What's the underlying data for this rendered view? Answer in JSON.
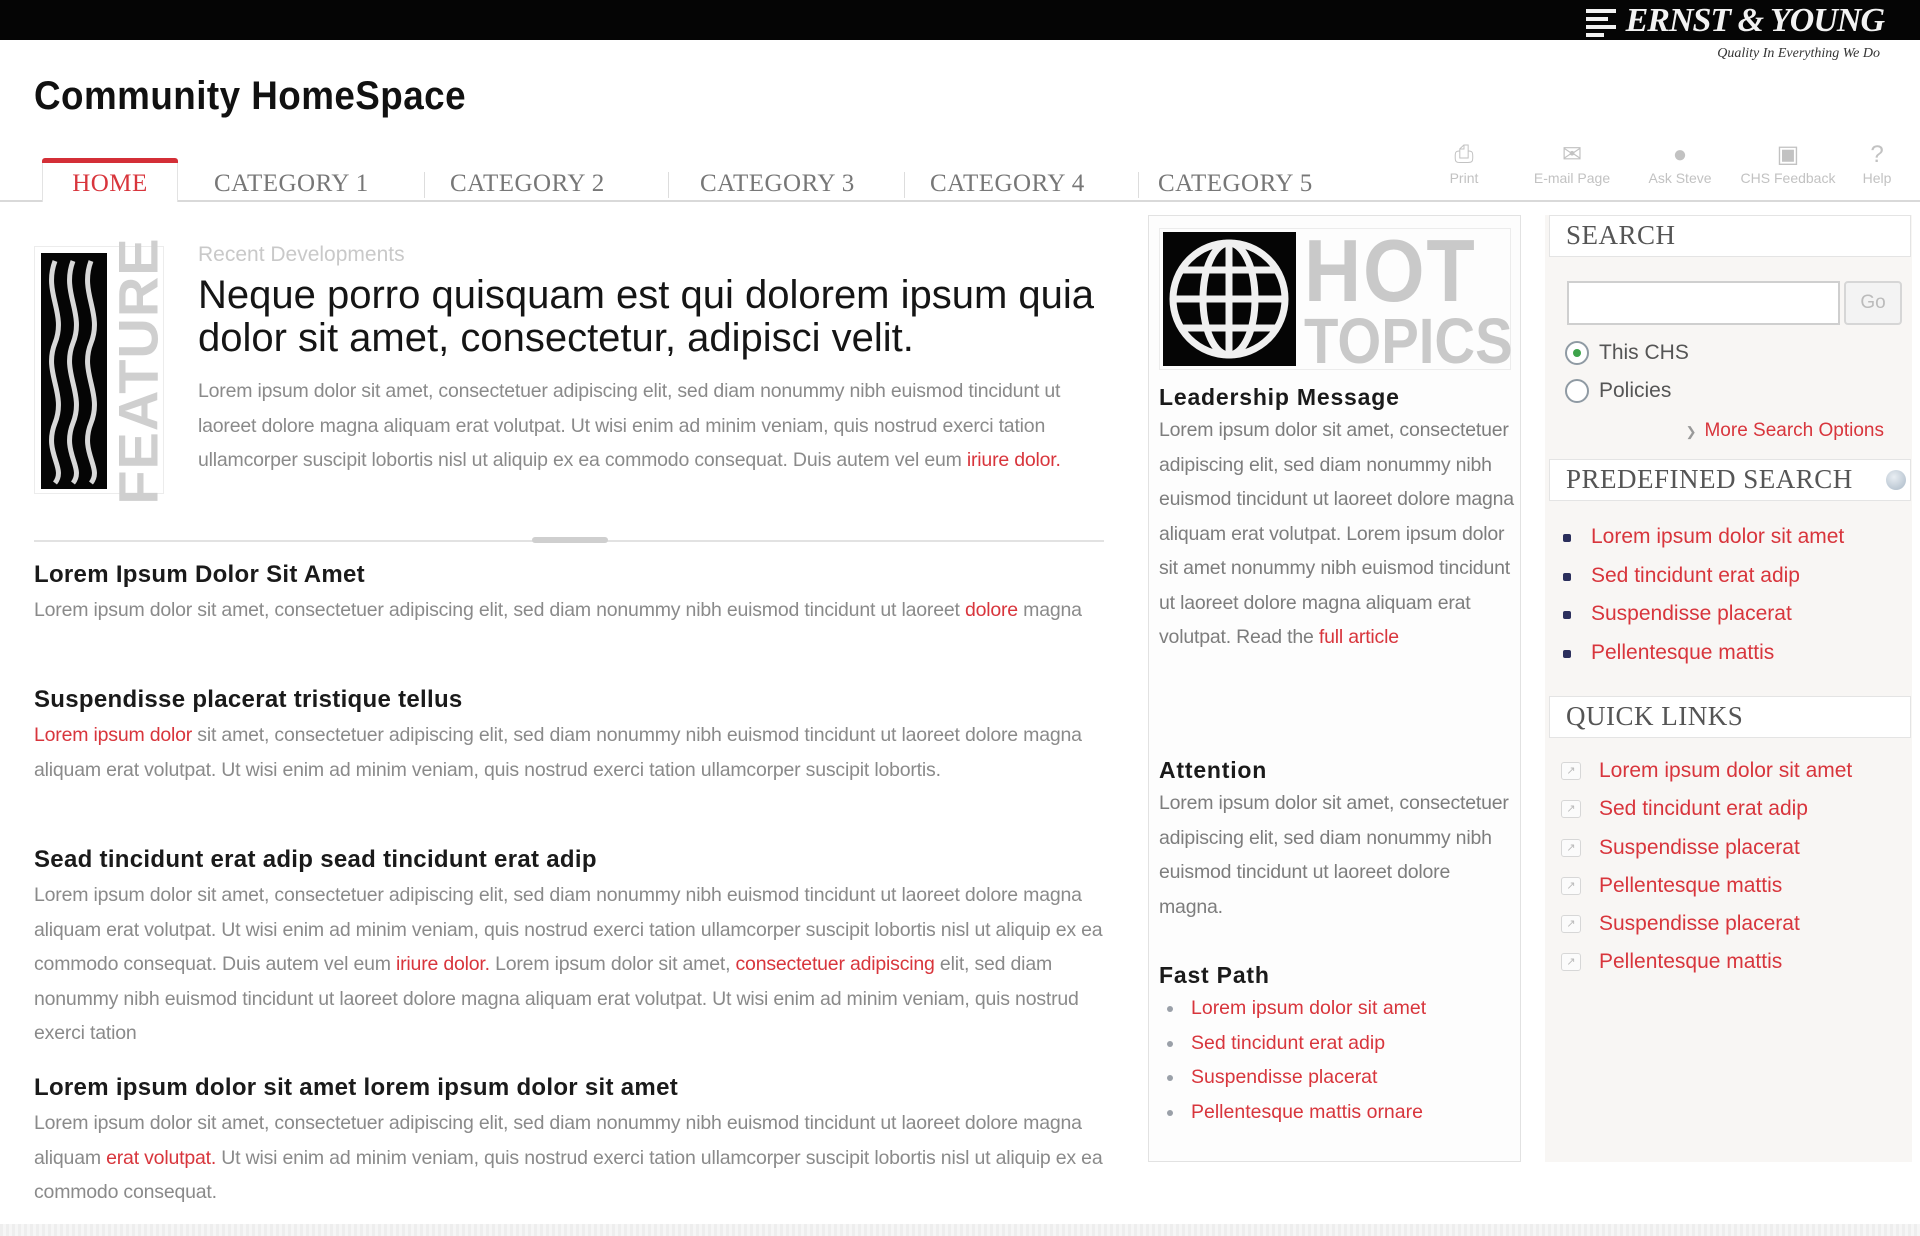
{
  "brand": {
    "logo_text": "ERNST & YOUNG",
    "tagline": "Quality In Everything We Do"
  },
  "header": {
    "title": "Community HomeSpace"
  },
  "nav": {
    "tabs": [
      {
        "label": "HOME",
        "active": true
      },
      {
        "label": "CATEGORY 1",
        "active": false
      },
      {
        "label": "CATEGORY 2",
        "active": false
      },
      {
        "label": "CATEGORY 3",
        "active": false
      },
      {
        "label": "CATEGORY 4",
        "active": false
      },
      {
        "label": "CATEGORY 5",
        "active": false
      }
    ],
    "tools": [
      {
        "label": "Print",
        "icon": "printer-icon"
      },
      {
        "label": "E-mail Page",
        "icon": "email-icon"
      },
      {
        "label": "Ask Steve",
        "icon": "person-icon"
      },
      {
        "label": "CHS Feedback",
        "icon": "feedback-icon"
      },
      {
        "label": "Help",
        "icon": "help-icon"
      }
    ]
  },
  "feature": {
    "badge": "FEATURE",
    "kicker": "Recent Developments",
    "headline": "Neque porro quisquam est qui dolorem ipsum quia dolor sit amet, consectetur, adipisci velit.",
    "lead_text": "Lorem ipsum dolor sit amet, consectetuer adipiscing elit, sed diam nonummy nibh euismod tincidunt ut laoreet dolore magna aliquam erat volutpat. Ut wisi enim ad minim veniam, quis nostrud exerci tation ullamcorper suscipit lobortis nisl ut aliquip ex ea commodo consequat. Duis autem vel eum ",
    "lead_link": "iriure dolor."
  },
  "articles": [
    {
      "title": "Lorem Ipsum Dolor Sit Amet",
      "parts": [
        {
          "text": "Lorem ipsum dolor sit amet, consectetuer adipiscing elit, sed diam nonummy nibh euismod tincidunt ut laoreet ",
          "link": false
        },
        {
          "text": "dolore",
          "link": true
        },
        {
          "text": " magna",
          "link": false
        }
      ]
    },
    {
      "title": "Suspendisse placerat tristique tellus",
      "parts": [
        {
          "text": "Lorem ipsum dolor",
          "link": true
        },
        {
          "text": " sit amet, consectetuer adipiscing elit, sed diam nonummy nibh euismod tincidunt ut laoreet dolore magna aliquam erat volutpat. Ut wisi enim ad minim veniam, quis nostrud exerci tation ullamcorper suscipit lobortis.",
          "link": false
        }
      ]
    },
    {
      "title": "Sead tincidunt erat adip sead tincidunt erat adip",
      "parts": [
        {
          "text": "Lorem ipsum dolor sit amet, consectetuer adipiscing elit, sed diam nonummy nibh euismod tincidunt ut laoreet dolore magna aliquam erat volutpat. Ut wisi enim ad minim veniam, quis nostrud exerci tation ullamcorper suscipit lobortis nisl ut aliquip ex ea commodo consequat. Duis autem vel eum ",
          "link": false
        },
        {
          "text": "iriure dolor.",
          "link": true
        },
        {
          "text": " Lorem ipsum dolor sit amet, ",
          "link": false
        },
        {
          "text": "consectetuer adipiscing",
          "link": true
        },
        {
          "text": " elit, sed diam nonummy nibh euismod tincidunt ut laoreet dolore magna aliquam erat volutpat. Ut wisi enim ad minim veniam, quis nostrud exerci tation",
          "link": false
        }
      ]
    },
    {
      "title": "Lorem ipsum dolor sit amet lorem ipsum dolor sit amet",
      "parts": [
        {
          "text": "Lorem ipsum dolor sit amet, consectetuer adipiscing elit, sed diam nonummy nibh euismod tincidunt ut laoreet dolore magna aliquam ",
          "link": false
        },
        {
          "text": "erat volutpat.",
          "link": true
        },
        {
          "text": " Ut wisi enim ad minim veniam, quis nostrud exerci tation ullamcorper suscipit lobortis nisl ut aliquip ex ea commodo consequat.",
          "link": false
        }
      ]
    }
  ],
  "hot_topics": {
    "banner_line1": "HOT",
    "banner_line2": "TOPICS",
    "leadership": {
      "title": "Leadership Message",
      "text": "Lorem ipsum dolor sit amet, consectetuer adipiscing elit, sed diam nonummy nibh euismod tincidunt ut laoreet dolore magna aliquam erat volutpat. Lorem ipsum dolor sit amet nonummy nibh euismod tincidunt ut laoreet dolore magna aliquam erat volutpat. Read the ",
      "link": "full article"
    },
    "attention": {
      "title": "Attention",
      "text": "Lorem ipsum dolor sit amet, consectetuer adipiscing elit, sed diam nonummy nibh euismod tincidunt ut laoreet dolore magna."
    },
    "fast_path": {
      "title": "Fast Path",
      "items": [
        "Lorem ipsum dolor sit amet",
        "Sed tincidunt erat adip",
        "Suspendisse placerat",
        "Pellentesque mattis ornare"
      ]
    }
  },
  "sidebar": {
    "search": {
      "title": "SEARCH",
      "input_value": "",
      "go_label": "Go",
      "options": [
        {
          "label": "This CHS",
          "selected": true
        },
        {
          "label": "Policies",
          "selected": false
        }
      ],
      "more_options": "More Search Options"
    },
    "predefined": {
      "title": "PREDEFINED SEARCH",
      "items": [
        "Lorem ipsum dolor sit amet",
        "Sed tincidunt erat adip",
        "Suspendisse placerat",
        "Pellentesque mattis"
      ]
    },
    "quick_links": {
      "title": "QUICK LINKS",
      "items": [
        "Lorem ipsum dolor sit amet",
        "Sed tincidunt erat adip",
        "Suspendisse placerat",
        "Pellentesque mattis",
        "Suspendisse placerat",
        "Pellentesque mattis"
      ]
    }
  },
  "colors": {
    "accent_red": "#d8353c",
    "top_bar": "#050505",
    "body_text_gray": "#8a8a8a",
    "sidebar_bg": "#f8f6f4"
  }
}
